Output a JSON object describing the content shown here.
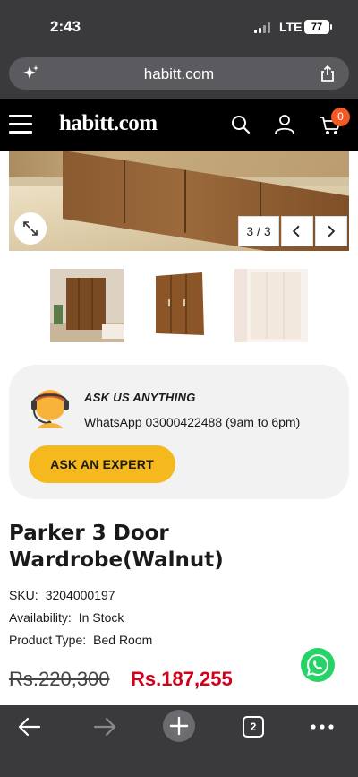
{
  "status_bar": {
    "time": "2:43",
    "network": "LTE",
    "battery": "77"
  },
  "browser": {
    "url": "habitt.com",
    "tab_count": "2"
  },
  "site_header": {
    "brand": "habitt.com",
    "cart_count": "0",
    "accent_color": "#f15a24"
  },
  "gallery": {
    "counter": "3 / 3",
    "thumbnails": [
      "wardrobe-room-photo",
      "wardrobe-studio-photo",
      "wardrobe-light-photo"
    ]
  },
  "expert_card": {
    "title": "ASK US ANYTHING",
    "whatsapp_line": "WhatsApp 03000422488 (9am to 6pm)",
    "button_label": "ASK AN EXPERT",
    "button_color": "#f5b91e"
  },
  "product": {
    "title": "Parker 3 Door Wardrobe(Walnut)",
    "sku_label": "SKU:",
    "sku": "3204000197",
    "availability_label": "Availability:",
    "availability": "In Stock",
    "type_label": "Product Type:",
    "type": "Bed Room",
    "old_price": "Rs.220,300",
    "new_price": "Rs.187,255",
    "sale_color": "#d0021b"
  },
  "icons": {
    "url_left": "sparkle-icon",
    "url_right": "share-icon",
    "header": [
      "menu-icon",
      "search-icon",
      "user-icon",
      "cart-icon"
    ],
    "toolbar": [
      "back-icon",
      "forward-icon",
      "plus-icon",
      "tabs-icon",
      "more-icon"
    ],
    "floating": "whatsapp-icon"
  }
}
